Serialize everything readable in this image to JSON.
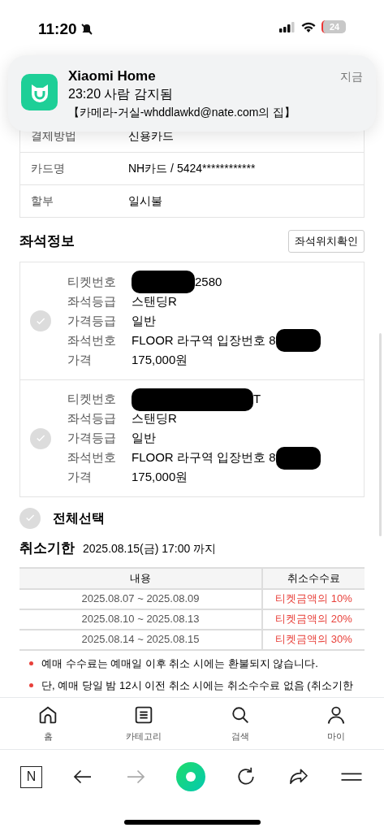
{
  "status_bar": {
    "time": "11:20",
    "battery": "24"
  },
  "notification": {
    "app": "Xiaomi Home",
    "time": "지금",
    "title": "23:20 사람 감지됨",
    "body": "【카메라-거실-whddlawkd@nate.com의 집】"
  },
  "payment": [
    {
      "label": "결제방법",
      "value": "신용카드"
    },
    {
      "label": "카드명",
      "value": "NH카드 / 5424************"
    },
    {
      "label": "할부",
      "value": "일시불"
    }
  ],
  "seat_info": {
    "title": "좌석정보",
    "button": "좌석위치확인",
    "tickets": [
      {
        "checked": false,
        "fields": [
          {
            "label": "티켓번호",
            "value": "2580",
            "redacted": true
          },
          {
            "label": "좌석등급",
            "value": "스탠딩R",
            "redacted": false
          },
          {
            "label": "가격등급",
            "value": "일반",
            "redacted": false
          },
          {
            "label": "좌석번호",
            "value": "FLOOR 라구역 입장번호 8",
            "redacted": true
          },
          {
            "label": "가격",
            "value": "175,000원",
            "redacted": false
          }
        ]
      },
      {
        "checked": false,
        "fields": [
          {
            "label": "티켓번호",
            "value": "T",
            "redacted": true
          },
          {
            "label": "좌석등급",
            "value": "스탠딩R",
            "redacted": false
          },
          {
            "label": "가격등급",
            "value": "일반",
            "redacted": false
          },
          {
            "label": "좌석번호",
            "value": "FLOOR 라구역 입장번호 8",
            "redacted": true
          },
          {
            "label": "가격",
            "value": "175,000원",
            "redacted": false
          }
        ]
      }
    ],
    "select_all": {
      "label": "전체선택",
      "checked": false
    }
  },
  "cancel": {
    "title": "취소기한",
    "deadline": "2025.08.15(금) 17:00 까지",
    "table": {
      "columns": [
        "내용",
        "취소수수료"
      ],
      "rows": [
        [
          "2025.08.07 ~ 2025.08.09",
          "티켓금액의 10%"
        ],
        [
          "2025.08.10 ~ 2025.08.13",
          "티켓금액의 20%"
        ],
        [
          "2025.08.14 ~ 2025.08.15",
          "티켓금액의 30%"
        ]
      ]
    },
    "notes": [
      "예매 수수료는 예매일 이후 취소 시에는 환불되지 않습니다.",
      "단, 예매 당일 밤 12시 이전 취소 시에는 취소수수료 없음 (취소기한"
    ]
  },
  "bottom_nav": [
    {
      "label": "홈",
      "kind": "home"
    },
    {
      "label": "카테고리",
      "kind": "category"
    },
    {
      "label": "검색",
      "kind": "search"
    },
    {
      "label": "마이",
      "kind": "my"
    }
  ],
  "browser_toolbar": [
    {
      "kind": "naver",
      "label": "N"
    },
    {
      "kind": "back",
      "disabled": false
    },
    {
      "kind": "forward",
      "disabled": true
    },
    {
      "kind": "green"
    },
    {
      "kind": "reload"
    },
    {
      "kind": "share"
    },
    {
      "kind": "menu"
    }
  ]
}
